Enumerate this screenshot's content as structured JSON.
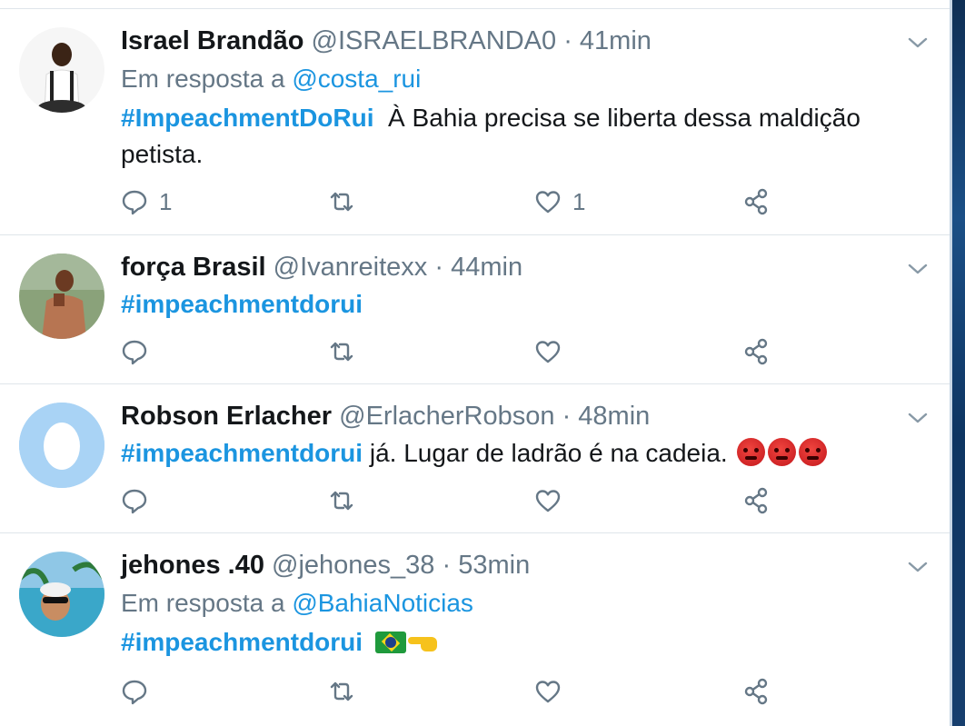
{
  "tweets": [
    {
      "name": "Israel Brandão",
      "handle": "@ISRAELBRANDA0",
      "time": "· 41min",
      "reply_prefix": "Em resposta a",
      "reply_to": "@costa_rui",
      "hashtag": "#ImpeachmentDoRui",
      "text": "  À Bahia precisa se liberta dessa maldição petista.",
      "replies": "1",
      "likes": "1"
    },
    {
      "name": "força Brasil",
      "handle": "@Ivanreitexx",
      "time": "· 44min",
      "hashtag": "#impeachmentdorui",
      "text": ""
    },
    {
      "name": "Robson Erlacher",
      "handle": "@ErlacherRobson",
      "time": "· 48min",
      "hashtag": "#impeachmentdorui",
      "text": " já. Lugar de ladrão é na cadeia."
    },
    {
      "name": "jehones .40",
      "handle": "@jehones_38",
      "time": "· 53min",
      "reply_prefix": "Em resposta a",
      "reply_to": "@BahiaNoticias",
      "hashtag": "#impeachmentdorui",
      "text": ""
    }
  ],
  "icons": {
    "reply": "reply-icon",
    "retweet": "retweet-icon",
    "like": "heart-icon",
    "share": "share-icon",
    "more": "chevron-down-icon"
  },
  "colors": {
    "link": "#1b95e0",
    "text": "#14171a",
    "muted": "#657786",
    "divider": "#dfe5ea"
  }
}
